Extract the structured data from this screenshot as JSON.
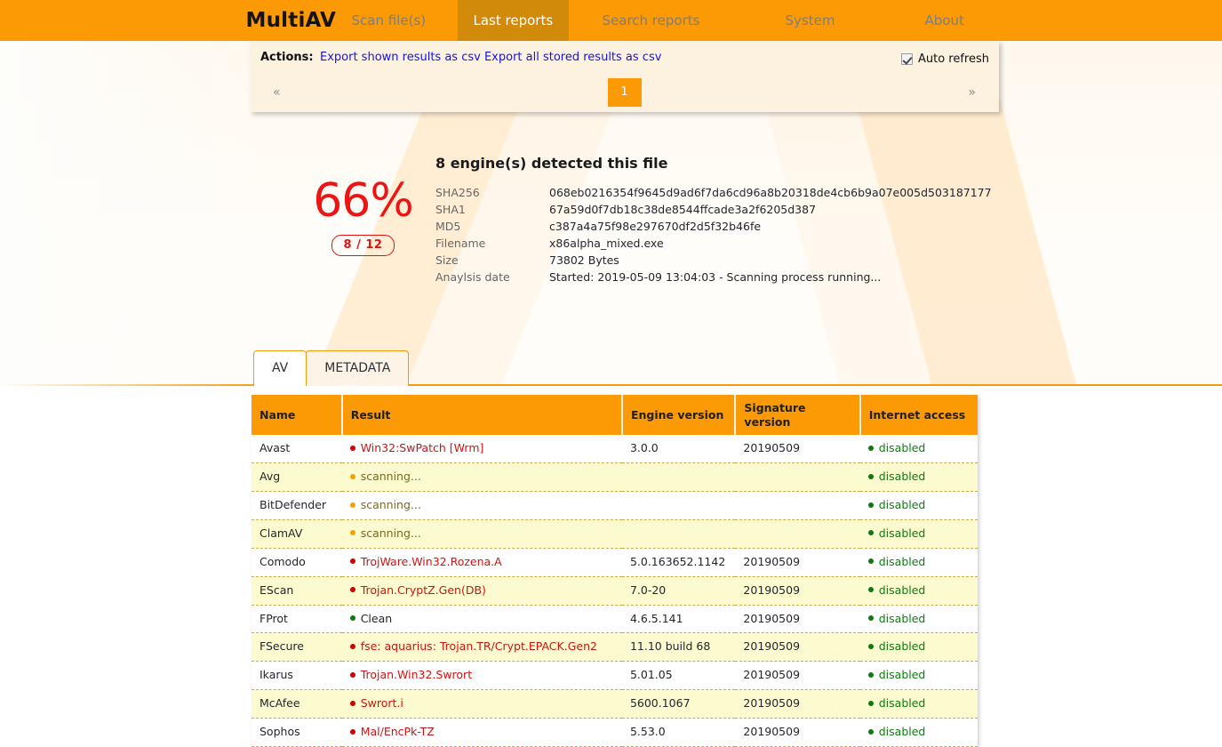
{
  "navbar": {
    "brand": "MultiAV",
    "links": [
      {
        "label": "Scan file(s)",
        "active": false
      },
      {
        "label": "Last reports",
        "active": true
      },
      {
        "label": "Search reports",
        "active": false
      },
      {
        "label": "System",
        "active": false
      },
      {
        "label": "About",
        "active": false
      }
    ]
  },
  "actions": {
    "label": "Actions:",
    "export_shown": "Export shown results as csv",
    "export_all": "Export all stored results as csv",
    "auto_refresh_label": "Auto refresh",
    "auto_refresh_checked": true
  },
  "pager": {
    "prev": "«",
    "next": "»",
    "pages": [
      "1"
    ],
    "current": "1"
  },
  "summary": {
    "detect_title": "8 engine(s) detected this file",
    "percent": "66%",
    "ratio": "8 / 12",
    "accent_red": "#ee1414",
    "fields": [
      {
        "key": "SHA256",
        "value": "068eb0216354f9645d9ad6f7da6cd96a8b20318de4cb6b9a07e005d503187177"
      },
      {
        "key": "SHA1",
        "value": "67a59d0f7db18c38de8544ffcade3a2f6205d387"
      },
      {
        "key": "MD5",
        "value": "c387a4a75f98e297670df2d5f32b46fe"
      },
      {
        "key": "Filename",
        "value": "x86alpha_mixed.exe"
      },
      {
        "key": "Size",
        "value": "73802 Bytes"
      },
      {
        "key": "Anaylsis date",
        "value": "Started: 2019-05-09 13:04:03 - Scanning process running..."
      }
    ]
  },
  "tabs": [
    {
      "label": "AV",
      "active": true
    },
    {
      "label": "METADATA",
      "active": false
    }
  ],
  "av_table": {
    "columns": [
      "Name",
      "Result",
      "Engine version",
      "Signature version",
      "Internet access"
    ],
    "rows": [
      {
        "name": "Avast",
        "result": "Win32:SwPatch [Wrm]",
        "status": "detected",
        "engine": "3.0.0",
        "signature": "20190509",
        "internet": "disabled"
      },
      {
        "name": "Avg",
        "result": "scanning...",
        "status": "scanning",
        "engine": "",
        "signature": "",
        "internet": "disabled"
      },
      {
        "name": "BitDefender",
        "result": "scanning...",
        "status": "scanning",
        "engine": "",
        "signature": "",
        "internet": "disabled"
      },
      {
        "name": "ClamAV",
        "result": "scanning...",
        "status": "scanning",
        "engine": "",
        "signature": "",
        "internet": "disabled"
      },
      {
        "name": "Comodo",
        "result": "TrojWare.Win32.Rozena.A",
        "status": "detected",
        "engine": "5.0.163652.1142",
        "signature": "20190509",
        "internet": "disabled"
      },
      {
        "name": "EScan",
        "result": "Trojan.CryptZ.Gen(DB)",
        "status": "detected",
        "engine": "7.0-20",
        "signature": "20190509",
        "internet": "disabled"
      },
      {
        "name": "FProt",
        "result": "Clean",
        "status": "clean",
        "engine": "4.6.5.141",
        "signature": "20190509",
        "internet": "disabled"
      },
      {
        "name": "FSecure",
        "result": "fse: aquarius: Trojan.TR/Crypt.EPACK.Gen2",
        "status": "detected",
        "engine": "11.10 build 68",
        "signature": "20190509",
        "internet": "disabled"
      },
      {
        "name": "Ikarus",
        "result": "Trojan.Win32.Swrort",
        "status": "detected",
        "engine": "5.01.05",
        "signature": "20190509",
        "internet": "disabled"
      },
      {
        "name": "McAfee",
        "result": "Swrort.i",
        "status": "detected",
        "engine": "5600.1067",
        "signature": "20190509",
        "internet": "disabled"
      },
      {
        "name": "Sophos",
        "result": "Mal/EncPk-TZ",
        "status": "detected",
        "engine": "5.53.0",
        "signature": "20190509",
        "internet": "disabled"
      }
    ]
  }
}
